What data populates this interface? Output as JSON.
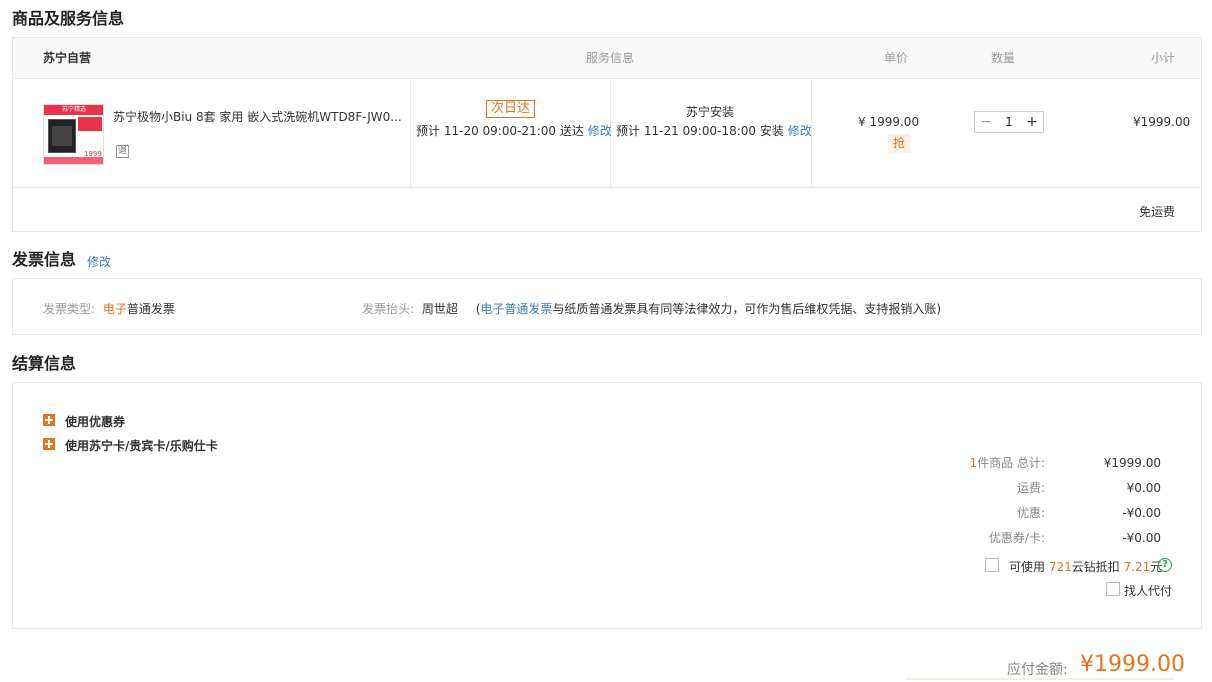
{
  "product_section": {
    "title": "商品及服务信息",
    "header": {
      "store": "苏宁自营",
      "service": "服务信息",
      "unit_price": "单价",
      "quantity": "数量",
      "subtotal": "小计"
    },
    "item": {
      "thumb_top_text": "苏宁精选",
      "thumb_price_text": "1999",
      "name": "苏宁极物小Biu 8套 家用 嵌入式洗碗机WTD8F-JW0...",
      "return_badge": "退",
      "delivery_tag": "次日达",
      "delivery_prefix": "预计",
      "delivery_time": "11-20 09:00-21:00",
      "delivery_suffix": "送达",
      "delivery_edit": "修改",
      "install_title": "苏宁安装",
      "install_prefix": "预计",
      "install_time": "11-21 09:00-18:00",
      "install_suffix": "安装",
      "install_edit": "修改",
      "unit_price": "¥ 1999.00",
      "qiang": "抢",
      "qty_minus": "−",
      "qty_value": "1",
      "qty_plus": "+",
      "subtotal": "¥1999.00"
    },
    "shipping": "免运费"
  },
  "invoice_section": {
    "title": "发票信息",
    "edit": "修改",
    "type_label": "发票类型:",
    "type_value_highlight": "电子",
    "type_value_rest": "普通发票",
    "header_label": "发票抬头:",
    "header_value": "周世超",
    "note_open": "(",
    "note_link": "电子普通发票",
    "note_text": "与纸质普通发票具有同等法律效力，可作为售后维权凭据、支持报销入账)"
  },
  "settlement_section": {
    "title": "结算信息",
    "coupon_label": "使用优惠券",
    "card_label": "使用苏宁卡/贵宾卡/乐购仕卡",
    "summary": {
      "count": "1",
      "count_label": "件商品 总计:",
      "total_value": "¥1999.00",
      "freight_label": "运费:",
      "freight_value": "¥0.00",
      "discount_label": "优惠:",
      "discount_value": "-¥0.00",
      "coupon_label": "优惠券/卡:",
      "coupon_value": "-¥0.00"
    },
    "cloud_diamond": {
      "prefix": "可使用",
      "amount": "721",
      "middle": "云钻抵扣",
      "value": "7.21",
      "suffix": "元",
      "help": "?"
    },
    "pay_for_me": "找人代付"
  },
  "payable": {
    "label": "应付金额:",
    "value": "¥1999.00"
  },
  "colors": {
    "accent": "#e67322",
    "link": "#3d7fbd",
    "help": "#2aa14b"
  }
}
